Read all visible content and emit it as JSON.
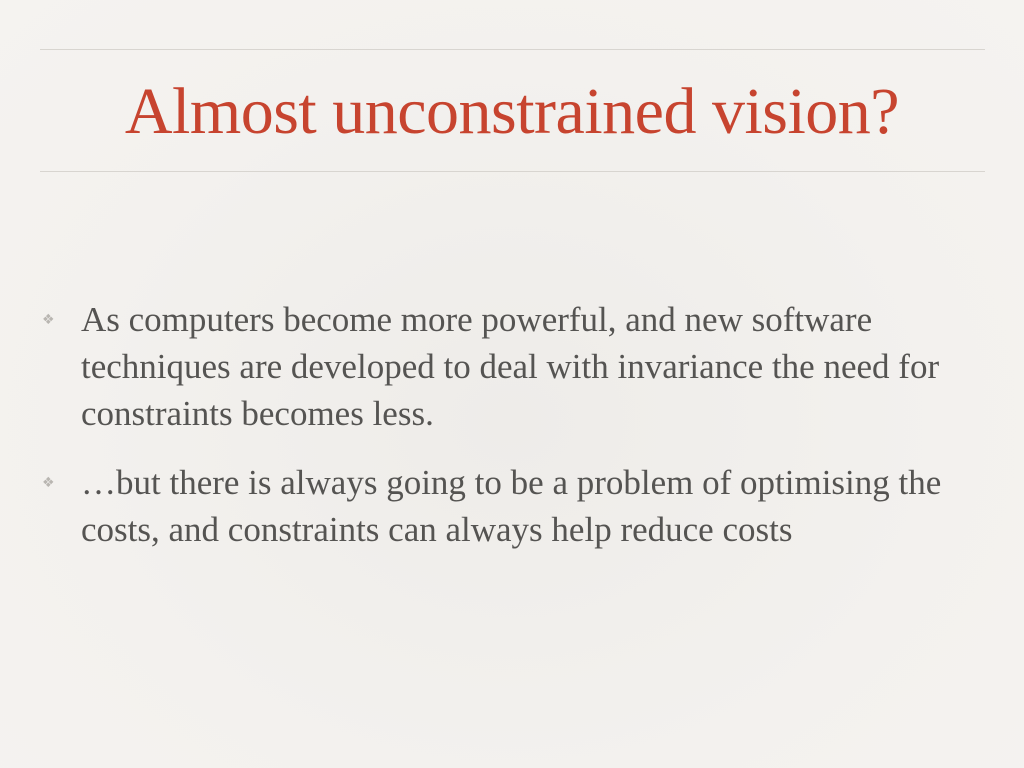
{
  "slide": {
    "title": "Almost unconstrained vision?",
    "bullets": [
      {
        "marker": "❖",
        "text": "As computers become more powerful, and new software techniques are developed to deal with invariance the need for constraints becomes less."
      },
      {
        "marker": "❖",
        "text": "…but there is always going to be a problem of optimising the costs, and constraints can always help reduce costs"
      }
    ]
  },
  "colors": {
    "title": "#c7442f",
    "body_text": "#555452",
    "background": "#f1efec",
    "rule": "#d8d5d0"
  }
}
